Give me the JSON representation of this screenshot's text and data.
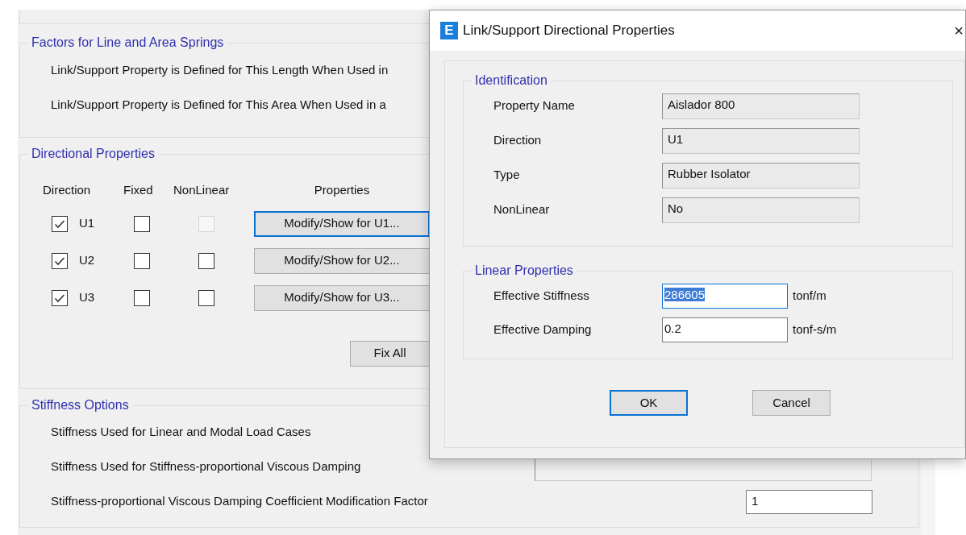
{
  "factors": {
    "title": "Factors for Line and Area Springs",
    "lines": [
      "Link/Support Property is Defined for This Length When Used in",
      "Link/Support Property is Defined for This Area When Used in a"
    ]
  },
  "directional": {
    "title": "Directional Properties",
    "columns": [
      "Direction",
      "Fixed",
      "NonLinear",
      "Properties"
    ],
    "rows": [
      {
        "label": "U1",
        "checked": true,
        "fixed": false,
        "nonlinear": false,
        "nonlinear_disabled": true,
        "button": "Modify/Show for U1...",
        "focused": true
      },
      {
        "label": "U2",
        "checked": true,
        "fixed": false,
        "nonlinear": false,
        "nonlinear_disabled": false,
        "button": "Modify/Show for U2...",
        "focused": false
      },
      {
        "label": "U3",
        "checked": true,
        "fixed": false,
        "nonlinear": false,
        "nonlinear_disabled": false,
        "button": "Modify/Show for U3...",
        "focused": false
      }
    ],
    "fix_all": "Fix All"
  },
  "stiffness": {
    "title": "Stiffness Options",
    "lines": [
      {
        "label": "Stiffness Used for Linear and Modal Load Cases",
        "kind": "hidden"
      },
      {
        "label": "Stiffness Used for Stiffness-proportional Viscous Damping",
        "kind": "box"
      },
      {
        "label": "Stiffness-proportional Viscous Damping Coefficient Modification Factor",
        "kind": "field",
        "value": "1"
      }
    ]
  },
  "dialog": {
    "icon": "E",
    "title": "Link/Support Directional Properties",
    "close": "×",
    "identification": {
      "title": "Identification",
      "rows": [
        {
          "label": "Property Name",
          "value": "Aislador 800"
        },
        {
          "label": "Direction",
          "value": "U1"
        },
        {
          "label": "Type",
          "value": "Rubber Isolator"
        },
        {
          "label": "NonLinear",
          "value": "No"
        }
      ]
    },
    "linear": {
      "title": "Linear Properties",
      "rows": [
        {
          "label": "Effective Stiffness",
          "value": "286605",
          "unit": "tonf/m",
          "selected": true
        },
        {
          "label": "Effective Damping",
          "value": "0.2",
          "unit": "tonf-s/m",
          "selected": false
        }
      ]
    },
    "buttons": [
      {
        "label": "OK",
        "default": true
      },
      {
        "label": "Cancel",
        "default": false
      }
    ]
  }
}
